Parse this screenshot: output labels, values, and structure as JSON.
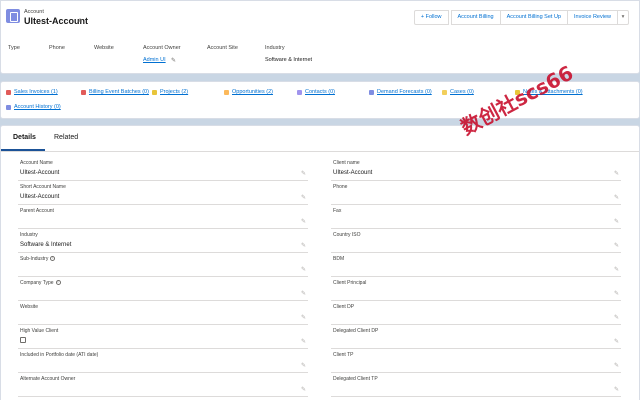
{
  "header": {
    "object_label": "Account",
    "record_title": "UItest-Account",
    "actions": [
      "+ Follow",
      "Account Billing",
      "Account Billing Set Up",
      "Invoice Review"
    ],
    "highlights": [
      {
        "label": "Type",
        "value": ""
      },
      {
        "label": "Phone",
        "value": ""
      },
      {
        "label": "Website",
        "value": ""
      },
      {
        "label": "Account Owner",
        "value": "Admin UI"
      },
      {
        "label": "Account Site",
        "value": ""
      },
      {
        "label": "Industry",
        "value": "Software & Internet"
      }
    ]
  },
  "related_links": [
    {
      "label": "Sales Invoices (1)",
      "color": "#e15b59"
    },
    {
      "label": "Billing Event Batches (0)",
      "color": "#e15b59"
    },
    {
      "label": "Projects (2)",
      "color": "#e8c53a"
    },
    {
      "label": "Opportunities (2)",
      "color": "#fcb95b"
    },
    {
      "label": "Contacts (0)",
      "color": "#a094ed"
    },
    {
      "label": "Demand Forecasts (0)",
      "color": "#7f8de1"
    },
    {
      "label": "Cases (0)",
      "color": "#f2cf5b"
    },
    {
      "label": "Notes & Attachments (0)",
      "color": "#e8c53a"
    },
    {
      "label": "Account History (0)",
      "color": "#7f8de1"
    }
  ],
  "tabs": [
    "Details",
    "Related"
  ],
  "left_fields": [
    {
      "label": "Account Name",
      "value": "UItest-Account"
    },
    {
      "label": "Short Account Name",
      "value": "UItest-Account"
    },
    {
      "label": "Parent Account",
      "value": ""
    },
    {
      "label": "Industry",
      "value": "Software & Internet"
    },
    {
      "label": "Sub-Industry",
      "value": ""
    },
    {
      "label": "Company Type",
      "value": ""
    },
    {
      "label": "Website",
      "value": ""
    },
    {
      "label": "High Value Client",
      "value": ""
    },
    {
      "label": "Included in Portfolio date (ATI date)",
      "value": ""
    },
    {
      "label": "Alternate Account Owner",
      "value": ""
    }
  ],
  "right_fields": [
    {
      "label": "Client name",
      "value": "UItest-Account"
    },
    {
      "label": "Phone",
      "value": ""
    },
    {
      "label": "Fax",
      "value": ""
    },
    {
      "label": "Country ISO",
      "value": ""
    },
    {
      "label": "BDM",
      "value": ""
    },
    {
      "label": "Client Principal",
      "value": ""
    },
    {
      "label": "Client DP",
      "value": ""
    },
    {
      "label": "Delegated Client DP",
      "value": ""
    },
    {
      "label": "Client TP",
      "value": ""
    },
    {
      "label": "Delegated Client TP",
      "value": ""
    }
  ],
  "icons": {
    "edit": "pencil-icon",
    "info": "info-icon",
    "hierarchy": "hierarchy-icon",
    "menu": "chevron-down-icon"
  },
  "watermark": "数创社scs66"
}
